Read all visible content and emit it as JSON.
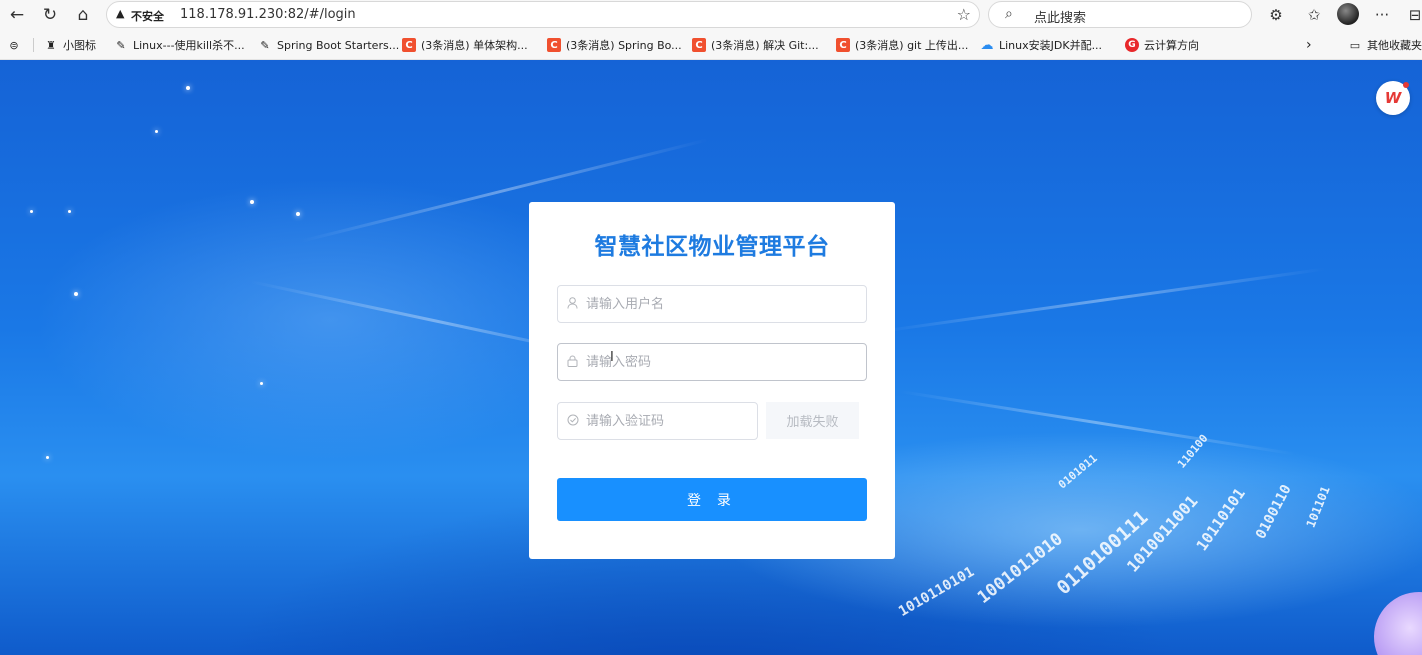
{
  "browser": {
    "security_label": "不安全",
    "url": "118.178.91.230:82/#/login",
    "search_placeholder": "点此搜索"
  },
  "bookmarks": [
    {
      "label": "小图标",
      "icon": "figure-icon"
    },
    {
      "label": "Linux---使用kill杀不...",
      "icon": "feather-icon"
    },
    {
      "label": "Spring Boot Starters...",
      "icon": "feather-icon"
    },
    {
      "label": "(3条消息) 单体架构...",
      "icon": "csdn-icon"
    },
    {
      "label": "(3条消息) Spring Bo...",
      "icon": "csdn-icon"
    },
    {
      "label": "(3条消息) 解决 Git:...",
      "icon": "csdn-icon"
    },
    {
      "label": "(3条消息) git 上传出...",
      "icon": "csdn-icon"
    },
    {
      "label": "Linux安装JDK并配...",
      "icon": "cloud-icon"
    },
    {
      "label": "云计算方向",
      "icon": "g-icon"
    }
  ],
  "bookmarks_other": "其他收藏夹",
  "login": {
    "title": "智慧社区物业管理平台",
    "username_placeholder": "请输入用户名",
    "password_placeholder": "请输入密码",
    "code_placeholder": "请输入验证码",
    "captcha_text": "加载失败",
    "login_button": "登 录"
  },
  "colors": {
    "title": "#1e7be0",
    "button": "#1890ff",
    "background": "#1a78e6"
  }
}
